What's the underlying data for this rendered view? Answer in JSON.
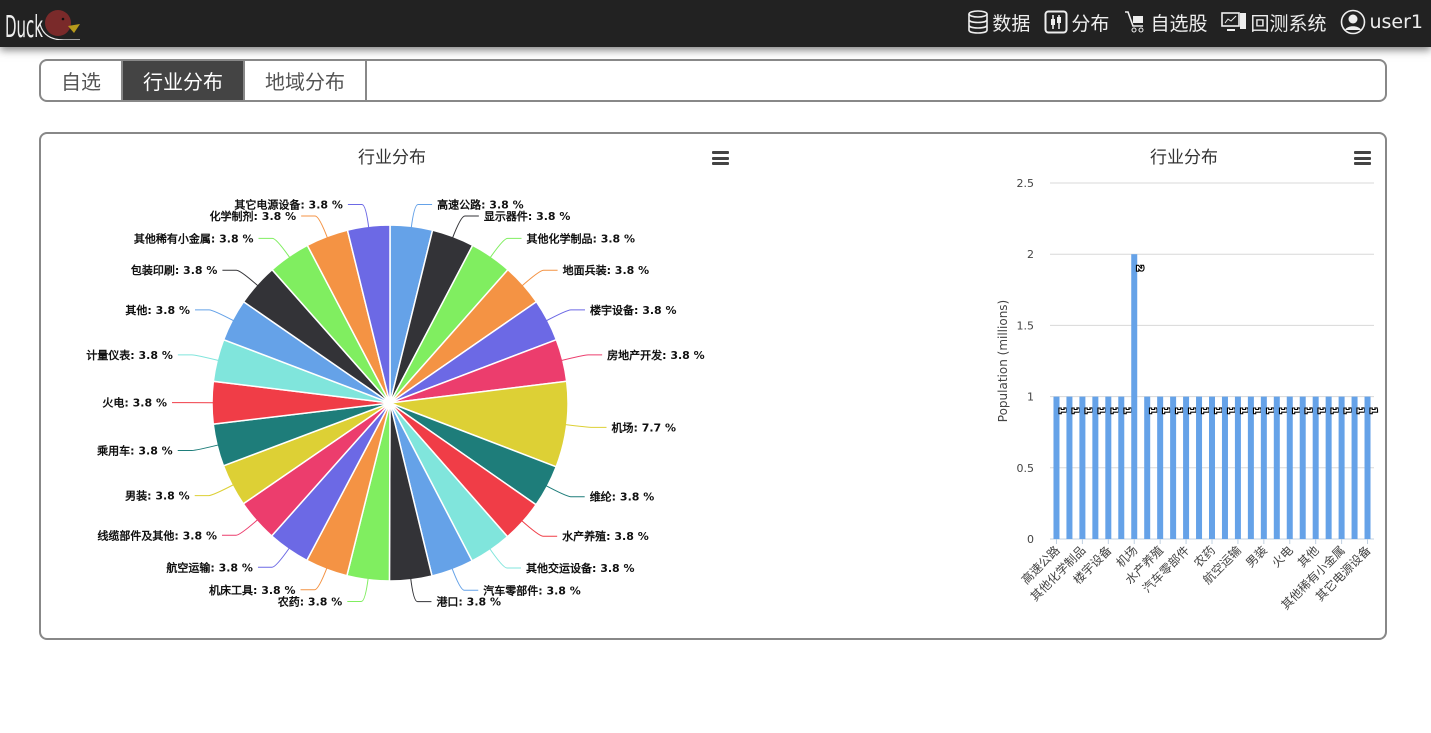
{
  "brand": {
    "logo_text": "Duck"
  },
  "nav": [
    {
      "icon": "database-icon",
      "label": "数据"
    },
    {
      "icon": "distribution-icon",
      "label": "分布"
    },
    {
      "icon": "cart-icon",
      "label": "自选股"
    },
    {
      "icon": "monitor-icon",
      "label": "回测系统"
    },
    {
      "icon": "user-icon",
      "label": "user1"
    }
  ],
  "tabs": [
    {
      "label": "自选",
      "active": false
    },
    {
      "label": "行业分布",
      "active": true
    },
    {
      "label": "地域分布",
      "active": false
    }
  ],
  "colors": {
    "palette": [
      "#65a2e8",
      "#333337",
      "#80ee60",
      "#f49344",
      "#6c69e5",
      "#ec3d6d",
      "#ddd035",
      "#1e7d7a",
      "#f03d47",
      "#80e5dc"
    ],
    "bar": "#65a2e8"
  },
  "chart_data": [
    {
      "type": "pie",
      "title": "行业分布",
      "label_format": "{name}: {pct} %",
      "slices": [
        {
          "name": "高速公路",
          "pct": 3.8
        },
        {
          "name": "显示器件",
          "pct": 3.8
        },
        {
          "name": "其他化学制品",
          "pct": 3.8
        },
        {
          "name": "地面兵装",
          "pct": 3.8
        },
        {
          "name": "楼宇设备",
          "pct": 3.8
        },
        {
          "name": "房地产开发",
          "pct": 3.8
        },
        {
          "name": "机场",
          "pct": 7.7
        },
        {
          "name": "维纶",
          "pct": 3.8
        },
        {
          "name": "水产养殖",
          "pct": 3.8
        },
        {
          "name": "其他交运设备",
          "pct": 3.8
        },
        {
          "name": "汽车零部件",
          "pct": 3.8
        },
        {
          "name": "港口",
          "pct": 3.8
        },
        {
          "name": "农药",
          "pct": 3.8
        },
        {
          "name": "机床工具",
          "pct": 3.8
        },
        {
          "name": "航空运输",
          "pct": 3.8
        },
        {
          "name": "线缆部件及其他",
          "pct": 3.8
        },
        {
          "name": "男装",
          "pct": 3.8
        },
        {
          "name": "乘用车",
          "pct": 3.8
        },
        {
          "name": "火电",
          "pct": 3.8
        },
        {
          "name": "计量仪表",
          "pct": 3.8
        },
        {
          "name": "其他",
          "pct": 3.8
        },
        {
          "name": "包装印刷",
          "pct": 3.8
        },
        {
          "name": "其他稀有小金属",
          "pct": 3.8
        },
        {
          "name": "化学制剂",
          "pct": 3.8
        },
        {
          "name": "其它电源设备",
          "pct": 3.8
        }
      ]
    },
    {
      "type": "bar",
      "title": "行业分布",
      "ylabel": "Population (millions)",
      "ylim": [
        0,
        2.5
      ],
      "yticks": [
        "0",
        "0.5",
        "1",
        "1.5",
        "2",
        "2.5"
      ],
      "grid": true,
      "categories": [
        "高速公路",
        "显示器件",
        "其他化学制品",
        "地面兵装",
        "楼宇设备",
        "房地产开发",
        "机场",
        "维纶",
        "水产养殖",
        "其他交运设备",
        "汽车零部件",
        "港口",
        "农药",
        "机床工具",
        "航空运输",
        "线缆部件及其他",
        "男装",
        "乘用车",
        "火电",
        "计量仪表",
        "其他",
        "包装印刷",
        "其他稀有小金属",
        "化学制剂",
        "其它电源设备"
      ],
      "values": [
        1,
        1,
        1,
        1,
        1,
        1,
        2,
        1,
        1,
        1,
        1,
        1,
        1,
        1,
        1,
        1,
        1,
        1,
        1,
        1,
        1,
        1,
        1,
        1,
        1
      ],
      "shown_tick_labels": [
        "高速公路",
        "其他化学制品",
        "楼宇设备",
        "机场",
        "水产养殖",
        "汽车零部件",
        "农药",
        "航空运输",
        "男装",
        "火电",
        "其他",
        "其他稀有小金属",
        "其它电源设备"
      ]
    }
  ]
}
